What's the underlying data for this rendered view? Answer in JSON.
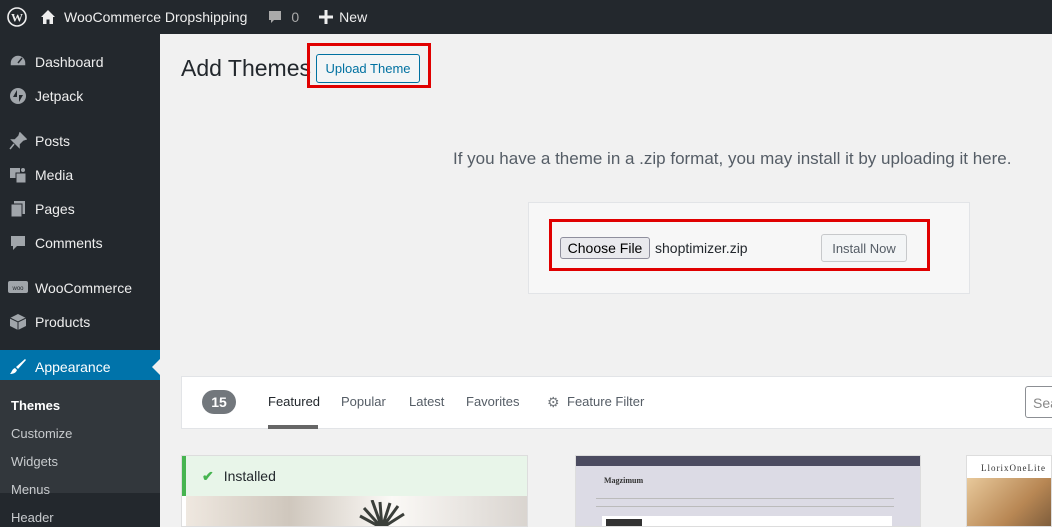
{
  "admin_bar": {
    "site_name": "WooCommerce Dropshipping",
    "comments_count": "0",
    "new_label": "New"
  },
  "sidebar": {
    "items": [
      {
        "label": "Dashboard",
        "icon": "dashboard-icon"
      },
      {
        "label": "Jetpack",
        "icon": "jetpack-icon"
      },
      {
        "label": "Posts",
        "icon": "pin-icon"
      },
      {
        "label": "Media",
        "icon": "media-icon"
      },
      {
        "label": "Pages",
        "icon": "pages-icon"
      },
      {
        "label": "Comments",
        "icon": "comment-icon"
      },
      {
        "label": "WooCommerce",
        "icon": "woo-icon"
      },
      {
        "label": "Products",
        "icon": "box-icon"
      },
      {
        "label": "Appearance",
        "icon": "brush-icon",
        "current": true
      }
    ],
    "submenu": [
      "Themes",
      "Customize",
      "Widgets",
      "Menus",
      "Header"
    ]
  },
  "main": {
    "title": "Add Themes",
    "upload_button": "Upload Theme",
    "upload_help": "If you have a theme in a .zip format, you may install it by uploading it here.",
    "choose_file": "Choose File",
    "file_name": "shoptimizer.zip",
    "install_button": "Install Now"
  },
  "filter": {
    "count": "15",
    "tabs": [
      "Featured",
      "Popular",
      "Latest",
      "Favorites"
    ],
    "feature_filter": "Feature Filter",
    "search_placeholder": "Search"
  },
  "themes": {
    "installed_label": "Installed",
    "theme2_name": "Magzimum",
    "theme3_name": "LlorixOneLite"
  },
  "colors": {
    "accent": "#0073aa",
    "highlight": "#e00000",
    "installed": "#46b450"
  }
}
